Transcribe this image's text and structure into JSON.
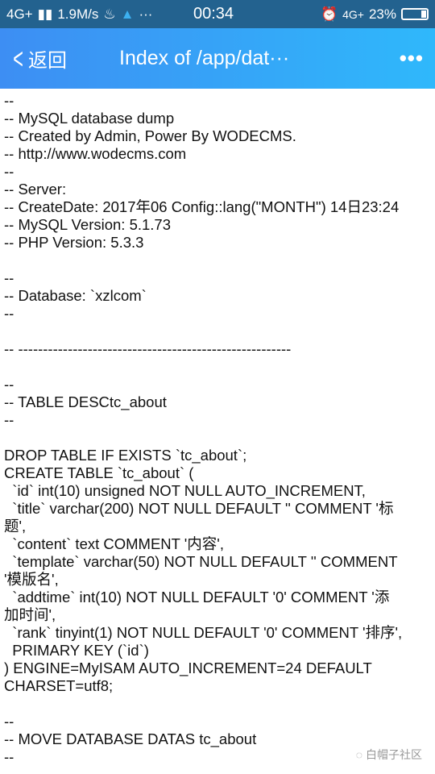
{
  "status_bar": {
    "network": "4G+",
    "speed": "1.9M/s",
    "time": "00:34",
    "network2": "4G+",
    "battery": "23%"
  },
  "nav": {
    "back_label": "返回",
    "title": "Index of /app/dat···",
    "more": "•••"
  },
  "lines": [
    "--",
    "-- MySQL database dump",
    "-- Created by Admin, Power By WODECMS.",
    "-- http://www.wodecms.com",
    "--",
    "-- Server:",
    "-- CreateDate: 2017年06 Config::lang(\"MONTH\") 14日23:24",
    "-- MySQL Version: 5.1.73",
    "-- PHP Version: 5.3.3",
    "",
    "--",
    "-- Database: `xzlcom`",
    "--",
    "",
    "-- -------------------------------------------------------",
    "",
    "--",
    "-- TABLE DESCtc_about",
    "--",
    "",
    "DROP TABLE IF EXISTS `tc_about`;",
    "CREATE TABLE `tc_about` (",
    "  `id` int(10) unsigned NOT NULL AUTO_INCREMENT,",
    "  `title` varchar(200) NOT NULL DEFAULT '' COMMENT '标",
    "题',",
    "  `content` text COMMENT '内容',",
    "  `template` varchar(50) NOT NULL DEFAULT '' COMMENT",
    "'模版名',",
    "  `addtime` int(10) NOT NULL DEFAULT '0' COMMENT '添",
    "加时间',",
    "  `rank` tinyint(1) NOT NULL DEFAULT '0' COMMENT '排序',",
    "  PRIMARY KEY (`id`)",
    ") ENGINE=MyISAM AUTO_INCREMENT=24 DEFAULT",
    "CHARSET=utf8;",
    "",
    "--",
    "-- MOVE DATABASE DATAS tc_about",
    "--"
  ],
  "watermark": "白帽子社区"
}
